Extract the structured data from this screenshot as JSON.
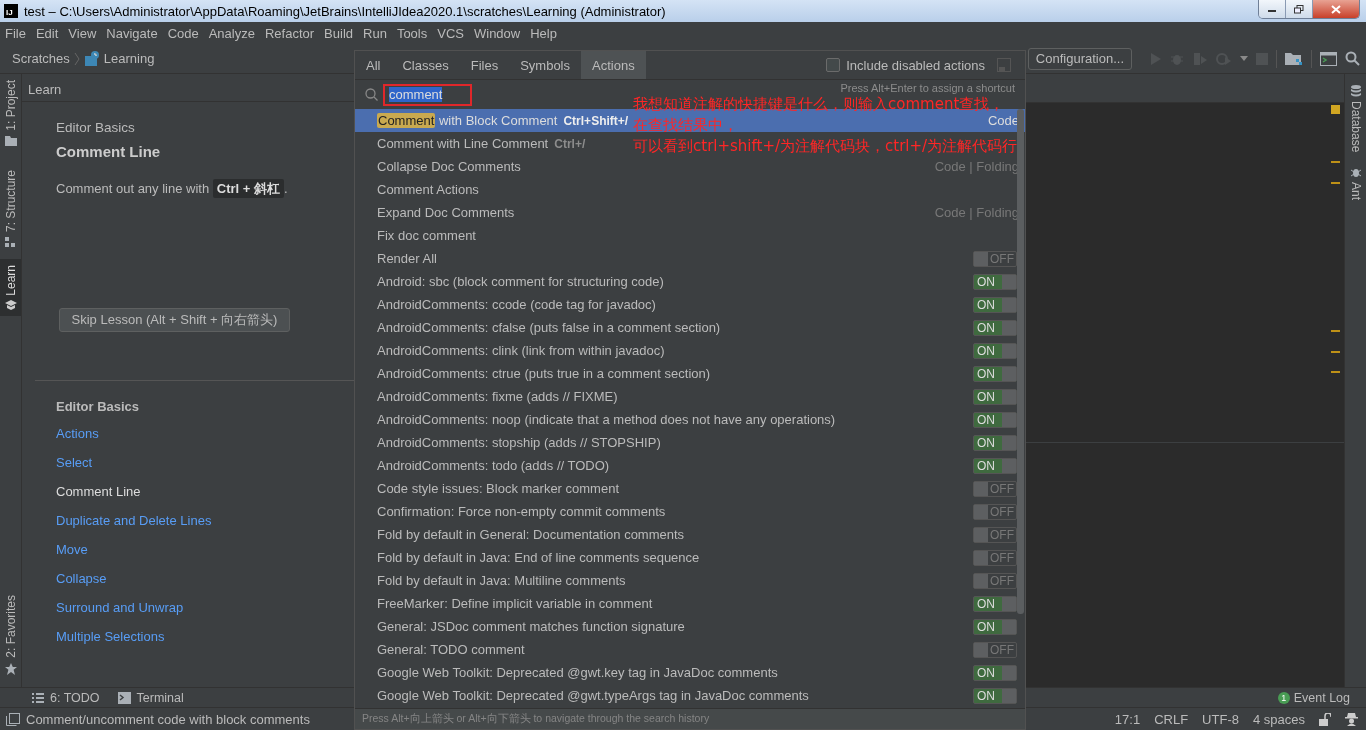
{
  "window": {
    "logo_text": "IJ",
    "title": "test – C:\\Users\\Administrator\\AppData\\Roaming\\JetBrains\\IntelliJIdea2020.1\\scratches\\Learning (Administrator)"
  },
  "menu": [
    "File",
    "Edit",
    "View",
    "Navigate",
    "Code",
    "Analyze",
    "Refactor",
    "Build",
    "Run",
    "Tools",
    "VCS",
    "Window",
    "Help"
  ],
  "breadcrumbs": [
    "Scratches",
    "Learning"
  ],
  "run_configuration": "Configuration...",
  "left_tool_tabs": [
    {
      "label": "1: Project",
      "selected": false
    },
    {
      "label": "7: Structure",
      "selected": false
    },
    {
      "label": "Learn",
      "selected": true
    },
    {
      "label": "2: Favorites",
      "selected": false
    }
  ],
  "right_tool_tabs": [
    "Database",
    "Ant"
  ],
  "learn_panel": {
    "title": "Learn",
    "module": "Editor Basics",
    "lesson": "Comment Line",
    "instruction": "Comment out any line with **Ctrl + 斜杠**.",
    "skip_button": "Skip Lesson (Alt + Shift + 向右箭头)",
    "lessons_header": "Editor Basics",
    "lessons": [
      {
        "label": "Actions",
        "selected": false
      },
      {
        "label": "Select",
        "selected": false
      },
      {
        "label": "Comment Line",
        "selected": true
      },
      {
        "label": "Duplicate and Delete Lines",
        "selected": false
      },
      {
        "label": "Move",
        "selected": false
      },
      {
        "label": "Collapse",
        "selected": false
      },
      {
        "label": "Surround and Unwrap",
        "selected": false
      },
      {
        "label": "Multiple Selections",
        "selected": false
      }
    ]
  },
  "popup": {
    "tabs": [
      {
        "label": "All",
        "selected": false
      },
      {
        "label": "Classes",
        "selected": false
      },
      {
        "label": "Files",
        "selected": false
      },
      {
        "label": "Symbols",
        "selected": false
      },
      {
        "label": "Actions",
        "selected": true
      }
    ],
    "include_disabled": {
      "label": "Include disabled actions",
      "checked": false
    },
    "search": {
      "value": "comment"
    },
    "hint": "Press Alt+Enter to assign a shortcut",
    "results": [
      {
        "kind": "action",
        "match": "Comment",
        "name": "with Block Comment",
        "shortcut": "Ctrl+Shift+/",
        "group": "Code",
        "selected": true
      },
      {
        "kind": "action",
        "name": "Comment with Line Comment",
        "shortcut": "Ctrl+/",
        "selected": false
      },
      {
        "kind": "action",
        "name": "Collapse Doc Comments",
        "group": "Code | Folding",
        "selected": false
      },
      {
        "kind": "action",
        "name": "Comment Actions",
        "selected": false
      },
      {
        "kind": "action",
        "name": "Expand Doc Comments",
        "group": "Code | Folding",
        "selected": false
      },
      {
        "kind": "action",
        "name": "Fix doc comment",
        "selected": false
      },
      {
        "kind": "option",
        "name": "Render All",
        "on": false,
        "toggle": "OFF",
        "selected": false
      },
      {
        "kind": "option",
        "name": "Android: sbc (block comment for structuring code)",
        "on": true,
        "toggle": "ON",
        "selected": false
      },
      {
        "kind": "option",
        "name": "AndroidComments: ccode (code tag for javadoc)",
        "on": true,
        "toggle": "ON",
        "selected": false
      },
      {
        "kind": "option",
        "name": "AndroidComments: cfalse (puts false in a comment section)",
        "on": true,
        "toggle": "ON",
        "selected": false
      },
      {
        "kind": "option",
        "name": "AndroidComments: clink (link from within javadoc)",
        "on": true,
        "toggle": "ON",
        "selected": false
      },
      {
        "kind": "option",
        "name": "AndroidComments: ctrue (puts true in a comment section)",
        "on": true,
        "toggle": "ON",
        "selected": false
      },
      {
        "kind": "option",
        "name": "AndroidComments: fixme (adds // FIXME)",
        "on": true,
        "toggle": "ON",
        "selected": false
      },
      {
        "kind": "option",
        "name": "AndroidComments: noop (indicate that a method does not have any operations)",
        "on": true,
        "toggle": "ON",
        "selected": false
      },
      {
        "kind": "option",
        "name": "AndroidComments: stopship (adds // STOPSHIP)",
        "on": true,
        "toggle": "ON",
        "selected": false
      },
      {
        "kind": "option",
        "name": "AndroidComments: todo (adds // TODO)",
        "on": true,
        "toggle": "ON",
        "selected": false
      },
      {
        "kind": "option",
        "name": "Code style issues: Block marker comment",
        "on": false,
        "toggle": "OFF",
        "selected": false
      },
      {
        "kind": "option",
        "name": "Confirmation: Force non-empty commit comments",
        "on": false,
        "toggle": "OFF",
        "selected": false
      },
      {
        "kind": "option",
        "name": "Fold by default in General: Documentation comments",
        "on": false,
        "toggle": "OFF",
        "selected": false
      },
      {
        "kind": "option",
        "name": "Fold by default in Java: End of line comments sequence",
        "on": false,
        "toggle": "OFF",
        "selected": false
      },
      {
        "kind": "option",
        "name": "Fold by default in Java: Multiline comments",
        "on": false,
        "toggle": "OFF",
        "selected": false
      },
      {
        "kind": "option",
        "name": "FreeMarker: Define implicit variable in comment",
        "on": true,
        "toggle": "ON",
        "selected": false
      },
      {
        "kind": "option",
        "name": "General: JSDoc comment matches function signature",
        "on": true,
        "toggle": "ON",
        "selected": false
      },
      {
        "kind": "option",
        "name": "General: TODO comment",
        "on": false,
        "toggle": "OFF",
        "selected": false
      },
      {
        "kind": "option",
        "name": "Google Web Toolkit: Deprecated @gwt.key tag in JavaDoc comments",
        "on": true,
        "toggle": "ON",
        "selected": false
      },
      {
        "kind": "option",
        "name": "Google Web Toolkit: Deprecated @gwt.typeArgs tag in JavaDoc comments",
        "on": true,
        "toggle": "ON",
        "selected": false
      }
    ],
    "footer": "Press Alt+向上箭头 or Alt+向下箭头 to navigate through the search history"
  },
  "annotation": [
    "我想知道注解的快捷键是什么，则输入comment查找，",
    "在查找结果中，",
    "可以看到ctrl+shift+/为注解代码块，ctrl+/为注解代码行"
  ],
  "tool_windows": [
    "6: TODO",
    "Terminal"
  ],
  "event_log": {
    "count": "1",
    "label": "Event Log"
  },
  "status_bar": {
    "message": "Comment/uncomment code with block comments",
    "items": [
      "17:1",
      "CRLF",
      "UTF-8",
      "4 spaces"
    ]
  }
}
